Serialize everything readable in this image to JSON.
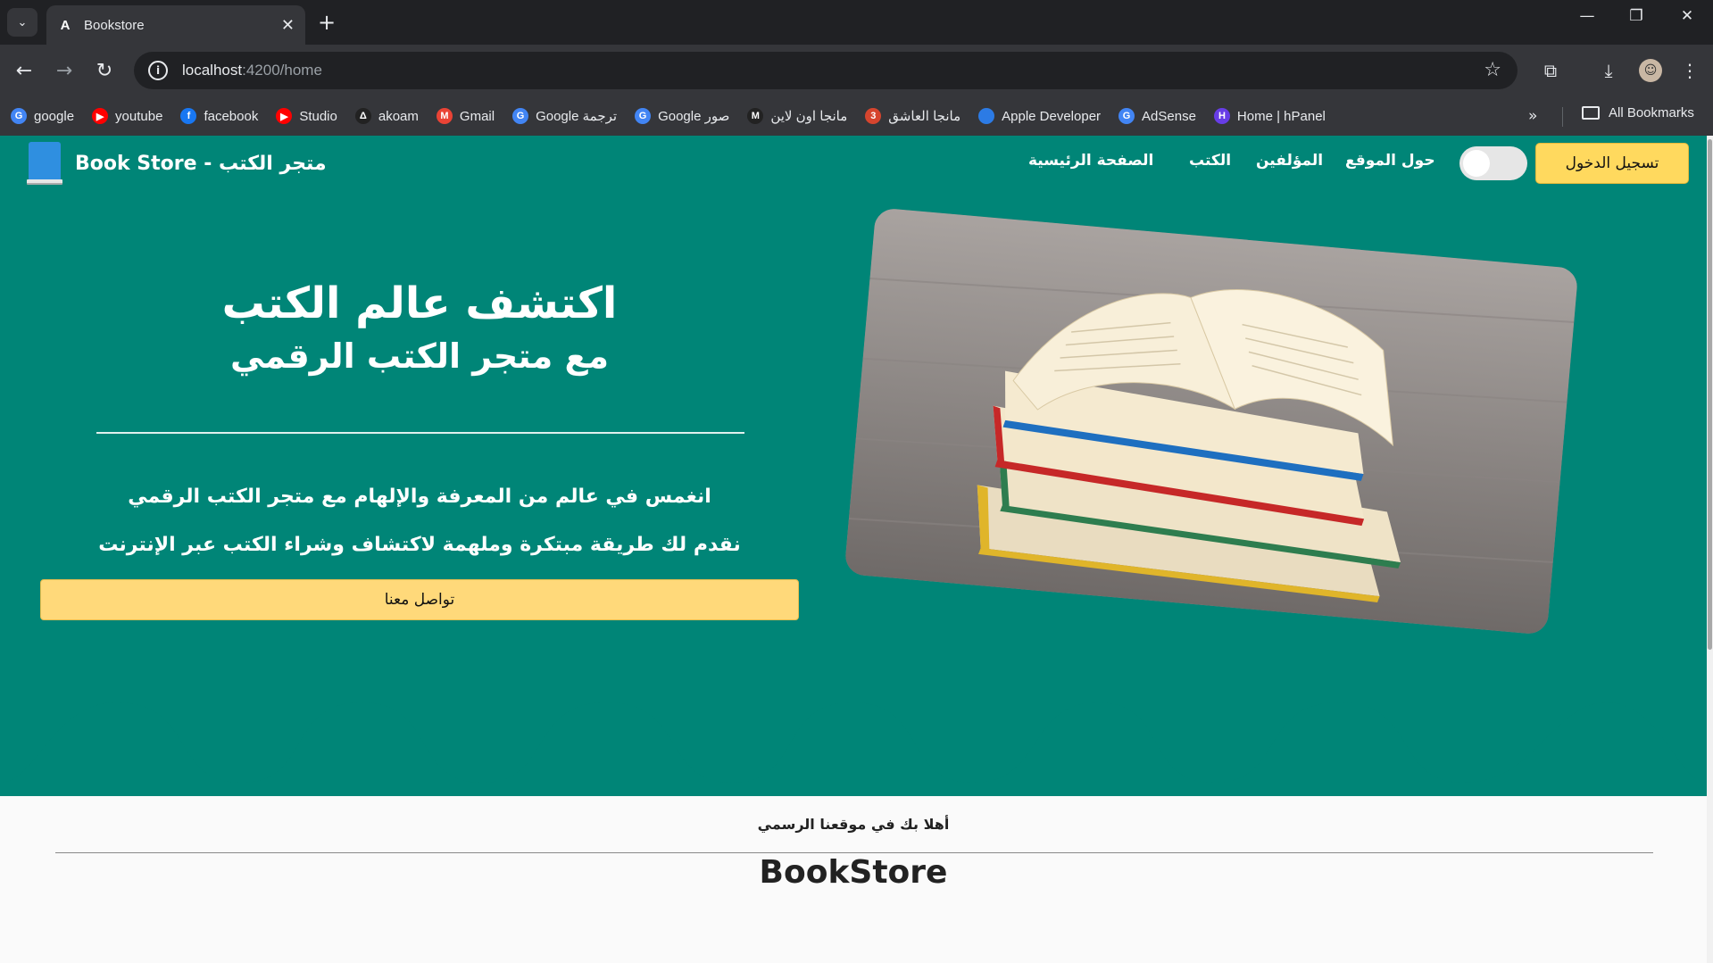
{
  "browser": {
    "tab_title": "Bookstore",
    "tab_favicon_letter": "A",
    "url_host": "localhost",
    "url_path": ":4200/home",
    "bookmarks": [
      {
        "label": "google",
        "icon": "google-icon",
        "color": "#4285f4",
        "glyph": "G"
      },
      {
        "label": "youtube",
        "icon": "youtube-icon",
        "color": "#ff0000",
        "glyph": "▶"
      },
      {
        "label": "facebook",
        "icon": "facebook-icon",
        "color": "#1877f2",
        "glyph": "f"
      },
      {
        "label": "Studio",
        "icon": "youtube-studio-icon",
        "color": "#ff0000",
        "glyph": "▶"
      },
      {
        "label": "akoam",
        "icon": "akoam-icon",
        "color": "#222222",
        "glyph": "Δ"
      },
      {
        "label": "Gmail",
        "icon": "gmail-icon",
        "color": "#ea4335",
        "glyph": "M"
      },
      {
        "label": "Google ترجمة",
        "icon": "google-translate-icon",
        "color": "#4285f4",
        "glyph": "G"
      },
      {
        "label": "Google صور",
        "icon": "google-icon",
        "color": "#4285f4",
        "glyph": "G"
      },
      {
        "label": "مانجا اون لاين",
        "icon": "manga-online-icon",
        "color": "#222222",
        "glyph": "M"
      },
      {
        "label": "مانجا العاشق",
        "icon": "manga-3asq-icon",
        "color": "#d6452e",
        "glyph": "3"
      },
      {
        "label": "Apple Developer",
        "icon": "apple-developer-icon",
        "color": "#2c7be5",
        "glyph": ""
      },
      {
        "label": "AdSense",
        "icon": "google-icon",
        "color": "#4285f4",
        "glyph": "G"
      },
      {
        "label": "Home | hPanel",
        "icon": "hostinger-icon",
        "color": "#673de6",
        "glyph": "H"
      }
    ],
    "all_bookmarks_label": "All Bookmarks"
  },
  "site": {
    "brand": "Book Store - متجر الكتب",
    "nav": {
      "home": "الصفحة الرئيسية",
      "books": "الكتب",
      "authors": "المؤلفين",
      "about": "حول الموقع"
    },
    "login_label": "تسجيل الدخول",
    "hero": {
      "title": "اكتشف عالم الكتب",
      "subtitle": "مع متجر الكتب الرقمي",
      "line1": "انغمس في عالم من المعرفة والإلهام مع متجر الكتب الرقمي",
      "line2": "نقدم لك طريقة مبتكرة وملهمة لاكتشاف وشراء الكتب عبر الإنترنت",
      "contact_label": "تواصل معنا"
    },
    "welcome": "أهلا بك في موقعنا الرسمي",
    "brand_big": "BookStore"
  },
  "colors": {
    "primary": "#008577",
    "accent": "#ffd97a",
    "page_bg": "#fafafa"
  }
}
